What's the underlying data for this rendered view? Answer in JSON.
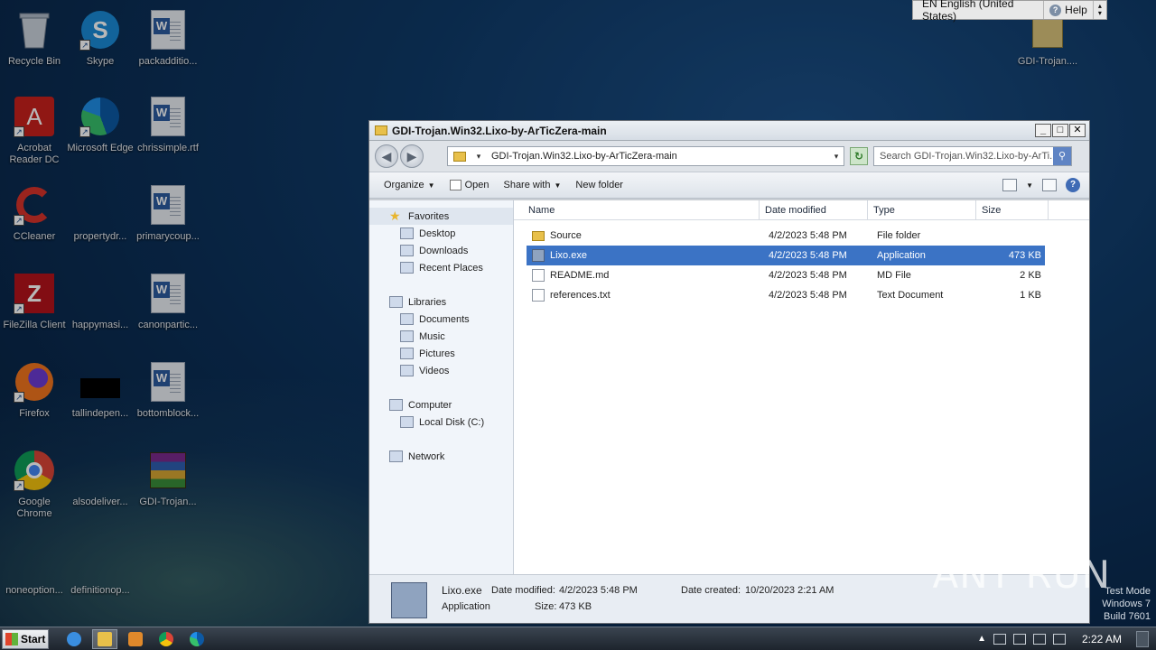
{
  "desktop": {
    "icons": [
      {
        "label": "Recycle Bin"
      },
      {
        "label": "Skype"
      },
      {
        "label": "packadditio..."
      },
      {
        "label": "Acrobat Reader DC"
      },
      {
        "label": "Microsoft Edge"
      },
      {
        "label": "chrissimple.rtf"
      },
      {
        "label": "CCleaner"
      },
      {
        "label": "propertydr..."
      },
      {
        "label": "primarycoup..."
      },
      {
        "label": "FileZilla Client"
      },
      {
        "label": "happymasi..."
      },
      {
        "label": "canonpartic..."
      },
      {
        "label": "Firefox"
      },
      {
        "label": "tallindepen..."
      },
      {
        "label": "bottomblock..."
      },
      {
        "label": "Google Chrome"
      },
      {
        "label": "alsodeliver..."
      },
      {
        "label": "GDI-Trojan..."
      },
      {
        "label": "noneoption..."
      },
      {
        "label": "definitionop..."
      },
      {
        "label": "GDI-Trojan...."
      }
    ]
  },
  "langbar": {
    "language": "EN English (United States)",
    "help": "Help"
  },
  "window": {
    "title": "GDI-Trojan.Win32.Lixo-by-ArTicZera-main",
    "address_path": "GDI-Trojan.Win32.Lixo-by-ArTicZera-main",
    "search_placeholder": "Search GDI-Trojan.Win32.Lixo-by-ArTi...",
    "commands": {
      "organize": "Organize",
      "open": "Open",
      "share_with": "Share with",
      "new_folder": "New folder"
    },
    "nav": {
      "favorites": "Favorites",
      "desktop": "Desktop",
      "downloads": "Downloads",
      "recent_places": "Recent Places",
      "libraries": "Libraries",
      "documents": "Documents",
      "music": "Music",
      "pictures": "Pictures",
      "videos": "Videos",
      "computer": "Computer",
      "local_disk": "Local Disk (C:)",
      "network": "Network"
    },
    "columns": {
      "name": "Name",
      "date_modified": "Date modified",
      "type": "Type",
      "size": "Size"
    },
    "files": [
      {
        "name": "Source",
        "date": "4/2/2023 5:48 PM",
        "type": "File folder",
        "size": ""
      },
      {
        "name": "Lixo.exe",
        "date": "4/2/2023 5:48 PM",
        "type": "Application",
        "size": "473 KB"
      },
      {
        "name": "README.md",
        "date": "4/2/2023 5:48 PM",
        "type": "MD File",
        "size": "2 KB"
      },
      {
        "name": "references.txt",
        "date": "4/2/2023 5:48 PM",
        "type": "Text Document",
        "size": "1 KB"
      }
    ],
    "details": {
      "name": "Lixo.exe",
      "type": "Application",
      "date_modified_label": "Date modified:",
      "date_modified": "4/2/2023 5:48 PM",
      "size_label": "Size:",
      "size": "473 KB",
      "date_created_label": "Date created:",
      "date_created": "10/20/2023 2:21 AM"
    }
  },
  "taskbar": {
    "start": "Start",
    "clock": "2:22 AM"
  },
  "watermark": "ANY RUN",
  "test_mode": {
    "line1": "Test Mode",
    "line2": "Windows 7",
    "line3": "Build 7601"
  }
}
